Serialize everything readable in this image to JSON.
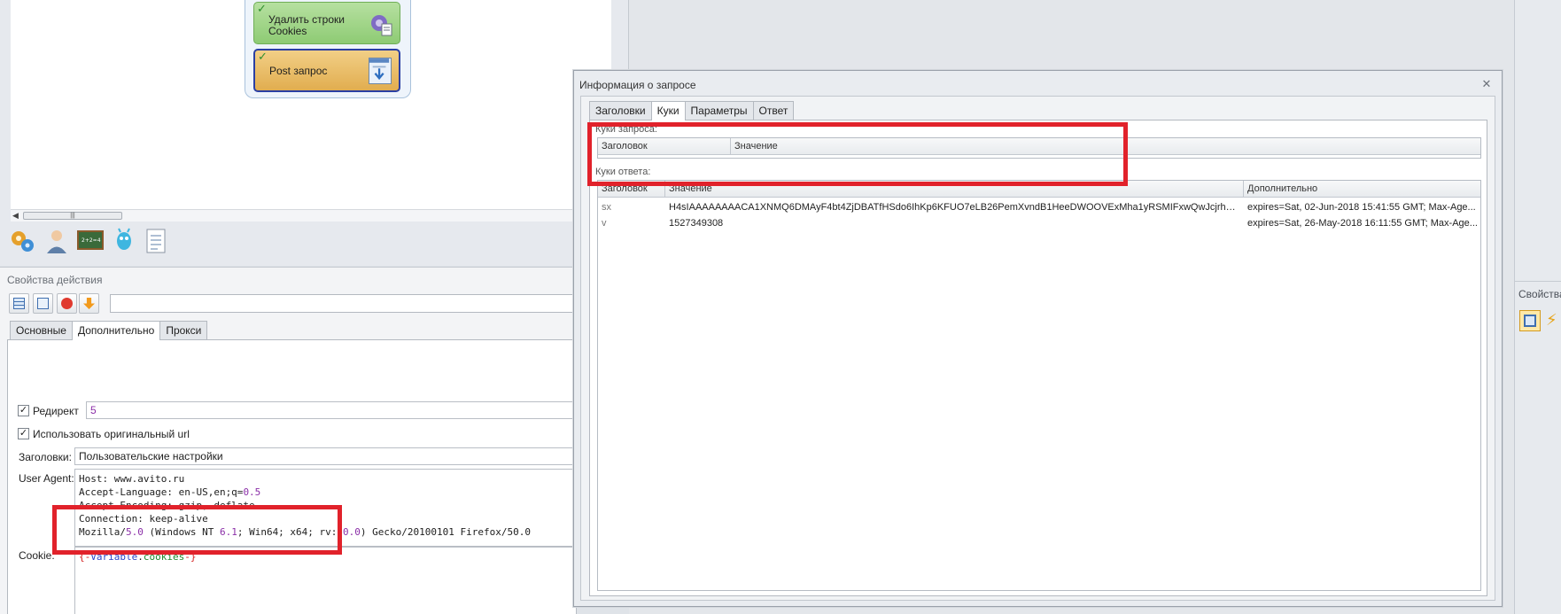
{
  "workflow": {
    "blocks": [
      {
        "label_line1": "Удалить строки",
        "label_line2": "Cookies",
        "icon": "gear-document-icon"
      },
      {
        "label": "Post запрос",
        "icon": "download-window-icon"
      }
    ],
    "toolbar_icons": [
      "gears-icon",
      "user-icon",
      "chalkboard-icon",
      "alien-icon",
      "document-list-icon"
    ]
  },
  "properties": {
    "title": "Свойства действия",
    "toolbar_icons": [
      "table-icon",
      "import-icon",
      "stop-icon",
      "arrow-down-icon"
    ],
    "tabs": [
      "Основные",
      "Дополнительно",
      "Прокси"
    ],
    "active_tab": "Дополнительно",
    "redirect": {
      "label": "Редирект",
      "checked": true,
      "value": "5"
    },
    "original_url": {
      "label": "Использовать оригинальный url",
      "checked": true
    },
    "headers": {
      "label": "Заголовки:",
      "value": "Пользовательские настройки"
    },
    "user_agent": {
      "label": "User Agent:",
      "lines": [
        {
          "a": "Host: www.avito.ru",
          "n": "",
          "b": "",
          "n2": "",
          "c": "",
          "n3": "",
          "d": ""
        },
        {
          "a": "Accept-Language: en-US,en;q=",
          "n": "0.5",
          "b": "",
          "n2": "",
          "c": "",
          "n3": "",
          "d": ""
        },
        {
          "a": "Accept-Encoding: gzip, deflate",
          "n": "",
          "b": "",
          "n2": "",
          "c": "",
          "n3": "",
          "d": ""
        },
        {
          "a": "Connection: keep-alive",
          "n": "",
          "b": "",
          "n2": "",
          "c": "",
          "n3": "",
          "d": ""
        },
        {
          "a": "Mozilla/",
          "n": "5.0",
          "b": " (Windows NT ",
          "n2": "6.1",
          "c": "; Win64; x64; rv:",
          "n3": "50.0",
          "d": ") Gecko/20100101 Firefox/50.0"
        }
      ]
    },
    "cookie": {
      "label": "Cookie:",
      "open": "{-",
      "kw": "Variable",
      "dot": ".",
      "name": "cookies",
      "close": "-}"
    }
  },
  "right_panel": {
    "title": "Свойства",
    "icons": [
      "panel-icon",
      "lightning-icon"
    ]
  },
  "dialog": {
    "title": "Информация о запросе",
    "tabs": [
      "Заголовки",
      "Куки",
      "Параметры",
      "Ответ"
    ],
    "active_tab": "Куки",
    "request_cookies": {
      "label": "Куки запроса:",
      "columns": [
        "Заголовок",
        "Значение"
      ],
      "rows": []
    },
    "response_cookies": {
      "label": "Куки ответа:",
      "columns": [
        "Заголовок",
        "Значение",
        "Дополнительно"
      ],
      "rows": [
        {
          "name": "sx",
          "value": "H4sIAAAAAAAACA1XNMQ6DMAyF4bt4ZjDBATfHSdo6IhKp6KFUO7eLB26PemXvndB1HeeDWOOVExMha1yRSMIFxwQwJcjrh%2Fen1...",
          "extra": "expires=Sat, 02-Jun-2018 15:41:55 GMT; Max-Age..."
        },
        {
          "name": "v",
          "value": "1527349308",
          "extra": "expires=Sat, 26-May-2018 16:11:55 GMT; Max-Age..."
        }
      ]
    }
  },
  "colors": {
    "highlight": "#e1222b",
    "post_block_border": "#2b3fa3",
    "delete_block": "#8ecb74",
    "post_block": "#e1ad4f"
  }
}
